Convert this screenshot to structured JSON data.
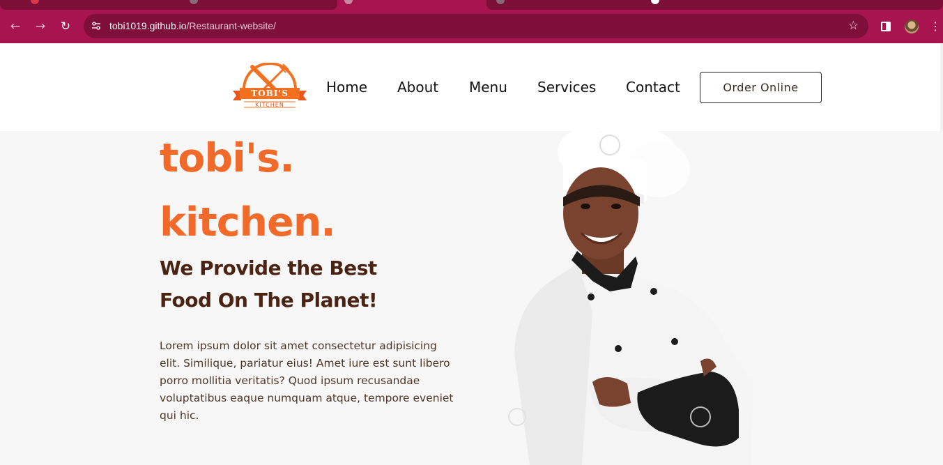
{
  "browser": {
    "url_host": "tobi1019.github.io",
    "url_path": "/Restaurant-website/",
    "icons": {
      "back": "arrow-left-icon",
      "forward": "arrow-right-icon",
      "reload": "reload-icon",
      "site_info": "tune-icon",
      "bookmark": "star-icon",
      "side_panel": "side-panel-icon",
      "menu": "kebab-menu-icon"
    },
    "colors": {
      "frame": "#a8144f",
      "omnibox": "#7e0e3a"
    }
  },
  "header": {
    "logo": {
      "name": "TOBI'S",
      "sub": "KITCHEN"
    },
    "nav": [
      "Home",
      "About",
      "Menu",
      "Services",
      "Contact"
    ],
    "cta": "Order Online"
  },
  "hero": {
    "brand_line1": "tobi's.",
    "brand_line2": "kitchen.",
    "tagline_line1": "We Provide the Best",
    "tagline_line2": "Food On The Planet!",
    "description": "Lorem ipsum dolor sit amet consectetur adipisicing elit. Similique, pariatur eius! Amet iure est sunt libero porro mollitia veritatis? Quod ipsum recusandae voluptatibus eaque numquam atque, tempore eveniet qui hic.",
    "colors": {
      "brand": "#f26a2a",
      "tagline": "#4a2313"
    }
  }
}
